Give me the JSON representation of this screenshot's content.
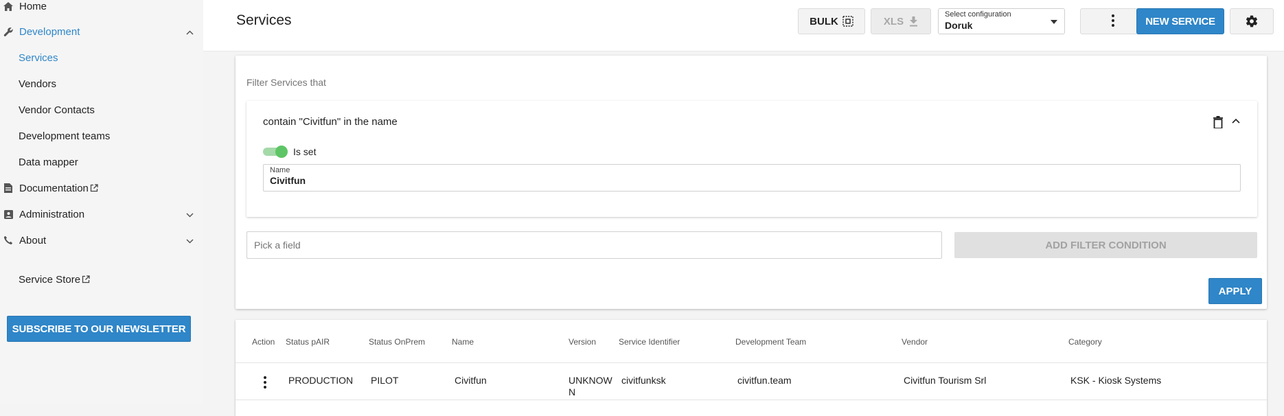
{
  "sidebar": {
    "home": "Home",
    "development": "Development",
    "services": "Services",
    "vendors": "Vendors",
    "vendor_contacts": "Vendor Contacts",
    "development_teams": "Development teams",
    "data_mapper": "Data mapper",
    "documentation": "Documentation",
    "administration": "Administration",
    "about": "About",
    "service_store": "Service Store",
    "subscribe": "SUBSCRIBE TO OUR NEWSLETTER"
  },
  "header": {
    "title": "Services",
    "bulk": "BULK",
    "xls": "XLS",
    "config_label": "Select configuration",
    "config_value": "Doruk",
    "new_service": "NEW SERVICE"
  },
  "filter": {
    "heading": "Filter Services that",
    "condition_title": "contain \"Civitfun\" in the name",
    "is_set_label": "Is set",
    "is_set": true,
    "name_label": "Name",
    "name_value": "Civitfun",
    "pick_placeholder": "Pick a field",
    "add_condition": "ADD FILTER CONDITION",
    "apply": "APPLY"
  },
  "table": {
    "columns": [
      "Action",
      "Status pAIR",
      "Status OnPrem",
      "Name",
      "Version",
      "Service Identifier",
      "Development Team",
      "Vendor",
      "Category"
    ],
    "rows": [
      {
        "status_pair": "PRODUCTION",
        "status_onprem": "PILOT",
        "name": "Civitfun",
        "version": "UNKNOW N",
        "service_identifier": "civitfunksk",
        "development_team": "civitfun.team",
        "vendor": "Civitfun Tourism Srl",
        "category": "KSK - Kiosk Systems"
      }
    ]
  },
  "colors": {
    "accent": "#2f86c8",
    "toggle_on": "#5ec566"
  }
}
